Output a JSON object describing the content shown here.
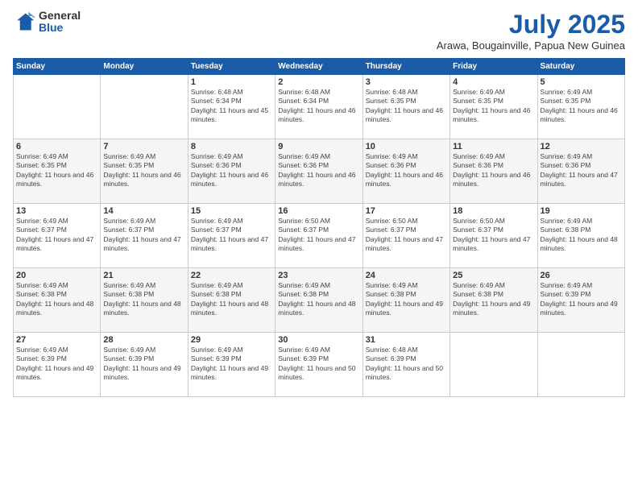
{
  "logo": {
    "general": "General",
    "blue": "Blue"
  },
  "title": "July 2025",
  "subtitle": "Arawa, Bougainville, Papua New Guinea",
  "days_of_week": [
    "Sunday",
    "Monday",
    "Tuesday",
    "Wednesday",
    "Thursday",
    "Friday",
    "Saturday"
  ],
  "weeks": [
    [
      {
        "day": "",
        "info": ""
      },
      {
        "day": "",
        "info": ""
      },
      {
        "day": "1",
        "info": "Sunrise: 6:48 AM\nSunset: 6:34 PM\nDaylight: 11 hours and 45 minutes."
      },
      {
        "day": "2",
        "info": "Sunrise: 6:48 AM\nSunset: 6:34 PM\nDaylight: 11 hours and 46 minutes."
      },
      {
        "day": "3",
        "info": "Sunrise: 6:48 AM\nSunset: 6:35 PM\nDaylight: 11 hours and 46 minutes."
      },
      {
        "day": "4",
        "info": "Sunrise: 6:49 AM\nSunset: 6:35 PM\nDaylight: 11 hours and 46 minutes."
      },
      {
        "day": "5",
        "info": "Sunrise: 6:49 AM\nSunset: 6:35 PM\nDaylight: 11 hours and 46 minutes."
      }
    ],
    [
      {
        "day": "6",
        "info": "Sunrise: 6:49 AM\nSunset: 6:35 PM\nDaylight: 11 hours and 46 minutes."
      },
      {
        "day": "7",
        "info": "Sunrise: 6:49 AM\nSunset: 6:35 PM\nDaylight: 11 hours and 46 minutes."
      },
      {
        "day": "8",
        "info": "Sunrise: 6:49 AM\nSunset: 6:36 PM\nDaylight: 11 hours and 46 minutes."
      },
      {
        "day": "9",
        "info": "Sunrise: 6:49 AM\nSunset: 6:36 PM\nDaylight: 11 hours and 46 minutes."
      },
      {
        "day": "10",
        "info": "Sunrise: 6:49 AM\nSunset: 6:36 PM\nDaylight: 11 hours and 46 minutes."
      },
      {
        "day": "11",
        "info": "Sunrise: 6:49 AM\nSunset: 6:36 PM\nDaylight: 11 hours and 46 minutes."
      },
      {
        "day": "12",
        "info": "Sunrise: 6:49 AM\nSunset: 6:36 PM\nDaylight: 11 hours and 47 minutes."
      }
    ],
    [
      {
        "day": "13",
        "info": "Sunrise: 6:49 AM\nSunset: 6:37 PM\nDaylight: 11 hours and 47 minutes."
      },
      {
        "day": "14",
        "info": "Sunrise: 6:49 AM\nSunset: 6:37 PM\nDaylight: 11 hours and 47 minutes."
      },
      {
        "day": "15",
        "info": "Sunrise: 6:49 AM\nSunset: 6:37 PM\nDaylight: 11 hours and 47 minutes."
      },
      {
        "day": "16",
        "info": "Sunrise: 6:50 AM\nSunset: 6:37 PM\nDaylight: 11 hours and 47 minutes."
      },
      {
        "day": "17",
        "info": "Sunrise: 6:50 AM\nSunset: 6:37 PM\nDaylight: 11 hours and 47 minutes."
      },
      {
        "day": "18",
        "info": "Sunrise: 6:50 AM\nSunset: 6:37 PM\nDaylight: 11 hours and 47 minutes."
      },
      {
        "day": "19",
        "info": "Sunrise: 6:49 AM\nSunset: 6:38 PM\nDaylight: 11 hours and 48 minutes."
      }
    ],
    [
      {
        "day": "20",
        "info": "Sunrise: 6:49 AM\nSunset: 6:38 PM\nDaylight: 11 hours and 48 minutes."
      },
      {
        "day": "21",
        "info": "Sunrise: 6:49 AM\nSunset: 6:38 PM\nDaylight: 11 hours and 48 minutes."
      },
      {
        "day": "22",
        "info": "Sunrise: 6:49 AM\nSunset: 6:38 PM\nDaylight: 11 hours and 48 minutes."
      },
      {
        "day": "23",
        "info": "Sunrise: 6:49 AM\nSunset: 6:38 PM\nDaylight: 11 hours and 48 minutes."
      },
      {
        "day": "24",
        "info": "Sunrise: 6:49 AM\nSunset: 6:38 PM\nDaylight: 11 hours and 49 minutes."
      },
      {
        "day": "25",
        "info": "Sunrise: 6:49 AM\nSunset: 6:38 PM\nDaylight: 11 hours and 49 minutes."
      },
      {
        "day": "26",
        "info": "Sunrise: 6:49 AM\nSunset: 6:39 PM\nDaylight: 11 hours and 49 minutes."
      }
    ],
    [
      {
        "day": "27",
        "info": "Sunrise: 6:49 AM\nSunset: 6:39 PM\nDaylight: 11 hours and 49 minutes."
      },
      {
        "day": "28",
        "info": "Sunrise: 6:49 AM\nSunset: 6:39 PM\nDaylight: 11 hours and 49 minutes."
      },
      {
        "day": "29",
        "info": "Sunrise: 6:49 AM\nSunset: 6:39 PM\nDaylight: 11 hours and 49 minutes."
      },
      {
        "day": "30",
        "info": "Sunrise: 6:49 AM\nSunset: 6:39 PM\nDaylight: 11 hours and 50 minutes."
      },
      {
        "day": "31",
        "info": "Sunrise: 6:48 AM\nSunset: 6:39 PM\nDaylight: 11 hours and 50 minutes."
      },
      {
        "day": "",
        "info": ""
      },
      {
        "day": "",
        "info": ""
      }
    ]
  ]
}
